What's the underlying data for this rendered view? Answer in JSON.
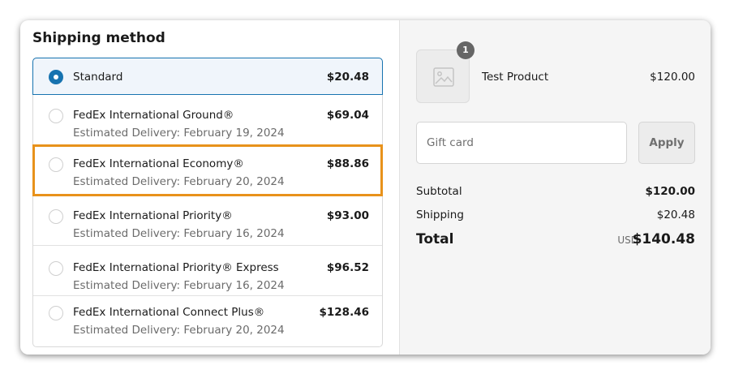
{
  "shipping": {
    "title": "Shipping method",
    "options": [
      {
        "name": "Standard",
        "delivery": "",
        "price": "$20.48",
        "selected": true
      },
      {
        "name": "FedEx International Ground®",
        "delivery": "Estimated Delivery: February 19, 2024",
        "price": "$69.04",
        "selected": false
      },
      {
        "name": "FedEx International Economy®",
        "delivery": "Estimated Delivery: February 20, 2024",
        "price": "$88.86",
        "selected": false
      },
      {
        "name": "FedEx International Priority®",
        "delivery": "Estimated Delivery: February 16, 2024",
        "price": "$93.00",
        "selected": false
      },
      {
        "name": "FedEx International Priority® Express",
        "delivery": "Estimated Delivery: February 16, 2024",
        "price": "$96.52",
        "selected": false
      },
      {
        "name": "FedEx International Connect Plus®",
        "delivery": "Estimated Delivery: February 20, 2024",
        "price": "$128.46",
        "selected": false
      }
    ]
  },
  "summary": {
    "product": {
      "quantity": "1",
      "name": "Test Product",
      "price": "$120.00"
    },
    "gift_card": {
      "placeholder": "Gift card",
      "value": "",
      "apply_label": "Apply"
    },
    "subtotal_label": "Subtotal",
    "subtotal_value": "$120.00",
    "shipping_label": "Shipping",
    "shipping_value": "$20.48",
    "total_label": "Total",
    "total_currency": "USD",
    "total_value": "$140.48"
  },
  "colors": {
    "accent": "#1773b0",
    "highlight": "#e8921b",
    "panel_bg": "#f5f5f5"
  }
}
